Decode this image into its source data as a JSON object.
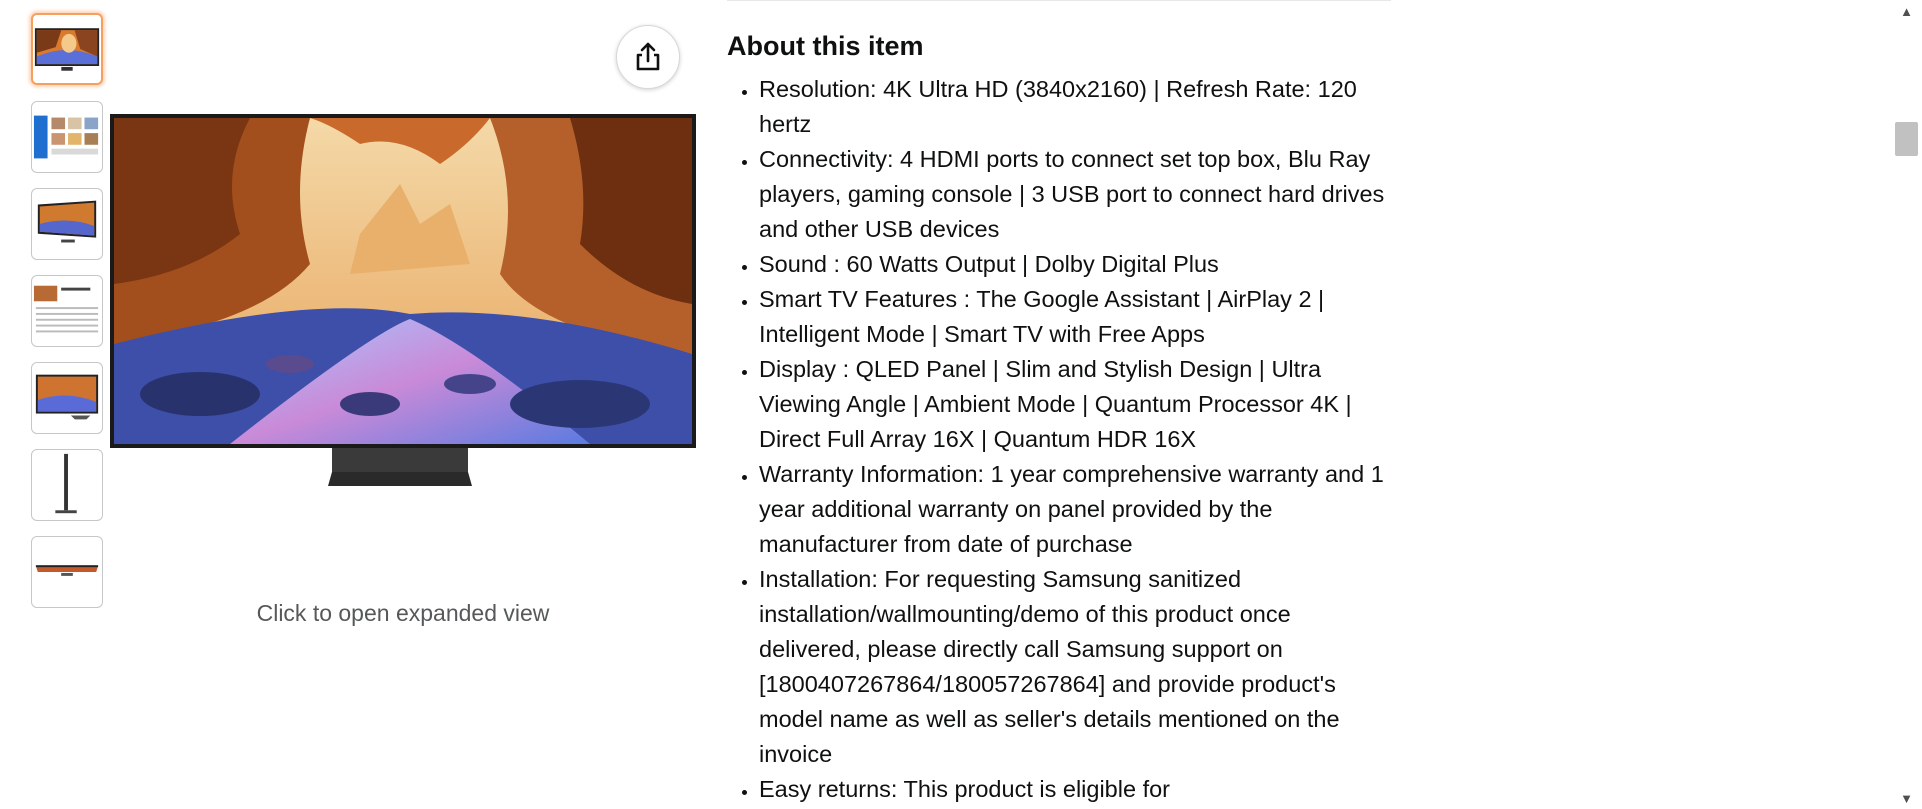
{
  "gallery": {
    "thumbnails": [
      {
        "name": "thumb-tv-front",
        "active": true
      },
      {
        "name": "thumb-features-grid",
        "active": false
      },
      {
        "name": "thumb-tv-angle",
        "active": false
      },
      {
        "name": "thumb-spec-sheet",
        "active": false
      },
      {
        "name": "thumb-tv-front-2",
        "active": false
      },
      {
        "name": "thumb-tv-side",
        "active": false
      },
      {
        "name": "thumb-tv-top",
        "active": false
      }
    ],
    "expand_hint": "Click to open expanded view",
    "share_icon": "share-icon"
  },
  "about": {
    "title": "About this item",
    "bullets": [
      "Resolution: 4K Ultra HD (3840x2160) | Refresh Rate: 120 hertz",
      "Connectivity: 4 HDMI ports to connect set top box, Blu Ray players, gaming console | 3 USB port to connect hard drives and other USB devices",
      "Sound : 60 Watts Output | Dolby Digital Plus",
      "Smart TV Features : The Google Assistant | AirPlay 2 | Intelligent Mode | Smart TV with Free Apps",
      "Display : QLED Panel | Slim and Stylish Design | Ultra Viewing Angle | Ambient Mode | Quantum Processor 4K | Direct Full Array 16X | Quantum HDR 16X",
      "Warranty Information: 1 year comprehensive warranty and 1 year additional warranty on panel provided by the manufacturer from date of purchase",
      "Installation: For requesting Samsung sanitized installation/wallmounting/demo of this product once delivered, please directly call Samsung support on [1800407267864/180057267864] and provide product's model name as well as seller's details mentioned on the invoice",
      "Easy returns: This product is eligible for"
    ]
  },
  "colors": {
    "active_thumb_border": "#f6a05f",
    "text": "#0f1111",
    "muted_text": "#565959"
  }
}
